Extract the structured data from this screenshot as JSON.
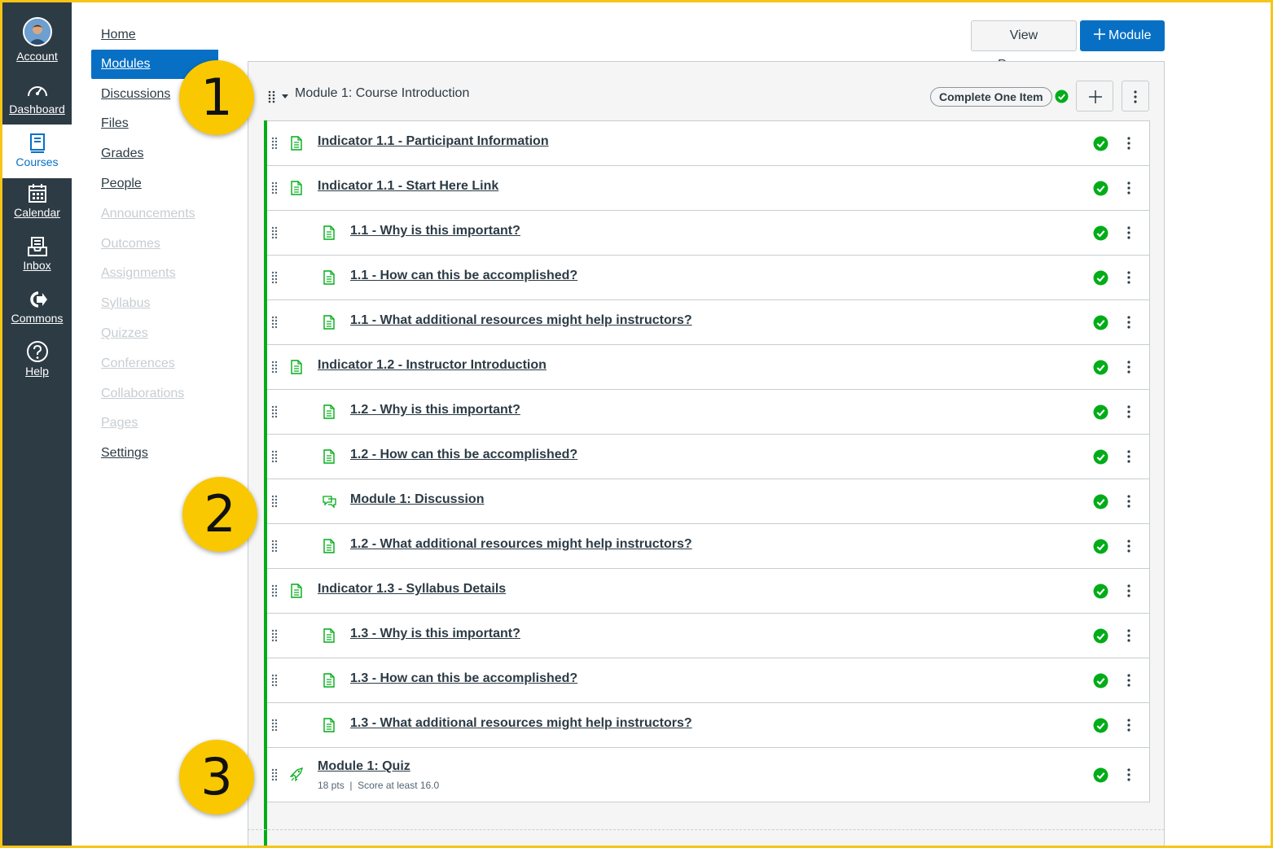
{
  "global_nav": {
    "items": [
      {
        "label": "Account",
        "icon": "avatar"
      },
      {
        "label": "Dashboard",
        "icon": "speedometer-icon"
      },
      {
        "label": "Courses",
        "icon": "book-icon"
      },
      {
        "label": "Calendar",
        "icon": "calendar-icon"
      },
      {
        "label": "Inbox",
        "icon": "inbox-icon"
      },
      {
        "label": "Commons",
        "icon": "commons-icon"
      },
      {
        "label": "Help",
        "icon": "question-icon"
      }
    ],
    "active": "Courses",
    "background": "#2d3b45"
  },
  "course_nav": {
    "items": [
      {
        "label": "Home",
        "state": "enabled"
      },
      {
        "label": "Modules",
        "state": "active"
      },
      {
        "label": "Discussions",
        "state": "enabled"
      },
      {
        "label": "Files",
        "state": "enabled"
      },
      {
        "label": "Grades",
        "state": "enabled"
      },
      {
        "label": "People",
        "state": "enabled"
      },
      {
        "label": "Announcements",
        "state": "disabled"
      },
      {
        "label": "Outcomes",
        "state": "disabled"
      },
      {
        "label": "Assignments",
        "state": "disabled"
      },
      {
        "label": "Syllabus",
        "state": "disabled"
      },
      {
        "label": "Quizzes",
        "state": "disabled"
      },
      {
        "label": "Conferences",
        "state": "disabled"
      },
      {
        "label": "Collaborations",
        "state": "disabled"
      },
      {
        "label": "Pages",
        "state": "disabled"
      },
      {
        "label": "Settings",
        "state": "enabled"
      }
    ]
  },
  "header": {
    "view_progress_label": "View Progress",
    "add_module_label": "Module"
  },
  "module": {
    "title": "Module 1: Course Introduction",
    "requirement": "Complete One Item",
    "items": [
      {
        "title": "Indicator 1.1 - Participant Information",
        "type": "page",
        "indent": 0
      },
      {
        "title": "Indicator 1.1 - Start Here Link",
        "type": "page",
        "indent": 0
      },
      {
        "title": "1.1 - Why is this important?",
        "type": "page",
        "indent": 1
      },
      {
        "title": "1.1 - How can this be accomplished?",
        "type": "page",
        "indent": 1
      },
      {
        "title": "1.1 - What additional resources might help instructors?",
        "type": "page",
        "indent": 1
      },
      {
        "title": "Indicator 1.2 - Instructor Introduction",
        "type": "page",
        "indent": 0
      },
      {
        "title": "1.2 - Why is this important?",
        "type": "page",
        "indent": 1
      },
      {
        "title": "1.2 - How can this be accomplished?",
        "type": "page",
        "indent": 1
      },
      {
        "title": "Module 1: Discussion",
        "type": "discussion",
        "indent": 1
      },
      {
        "title": "1.2 - What additional resources might help instructors?",
        "type": "page",
        "indent": 1
      },
      {
        "title": "Indicator 1.3 - Syllabus Details",
        "type": "page",
        "indent": 0
      },
      {
        "title": "1.3 - Why is this important?",
        "type": "page",
        "indent": 1
      },
      {
        "title": "1.3 - How can this be accomplished?",
        "type": "page",
        "indent": 1
      },
      {
        "title": "1.3 - What additional resources might help instructors?",
        "type": "page",
        "indent": 1
      },
      {
        "title": "Module 1: Quiz",
        "type": "quiz",
        "indent": 0,
        "points": "18 pts",
        "separator": "|",
        "requirement": "Score at least 16.0"
      }
    ]
  },
  "callouts": [
    "1",
    "2",
    "3"
  ],
  "colors": {
    "accent": "#0770c4",
    "complete_green": "#00ac18",
    "callout_yellow": "#f9c800",
    "frame_yellow": "#f5c518"
  }
}
